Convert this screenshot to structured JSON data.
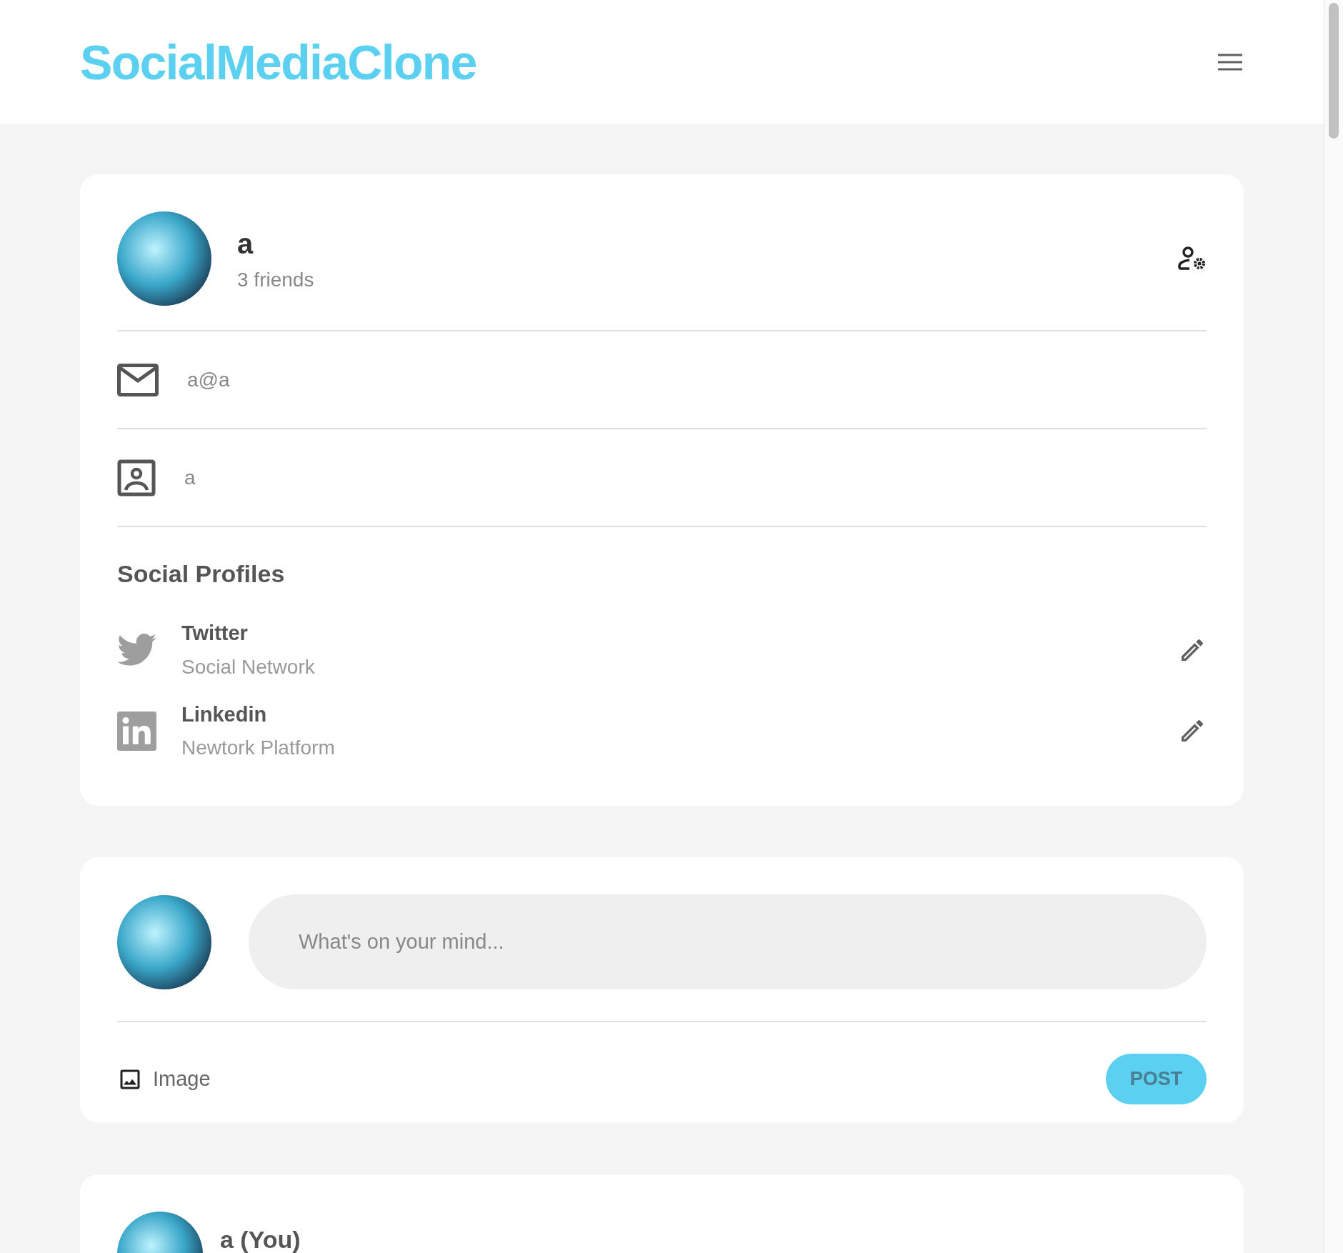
{
  "header": {
    "logo": "SocialMediaClone"
  },
  "profile": {
    "name": "a",
    "friends": "3 friends",
    "email": "a@a",
    "username": "a",
    "social_title": "Social Profiles",
    "socials": [
      {
        "kind": "twitter",
        "name": "Twitter",
        "subtitle": "Social Network"
      },
      {
        "kind": "linkedin",
        "name": "Linkedin",
        "subtitle": "Newtork Platform"
      }
    ]
  },
  "composer": {
    "placeholder": "What's on your mind...",
    "image_label": "Image",
    "post_button": "POST"
  },
  "post": {
    "author": "a (You)"
  }
}
